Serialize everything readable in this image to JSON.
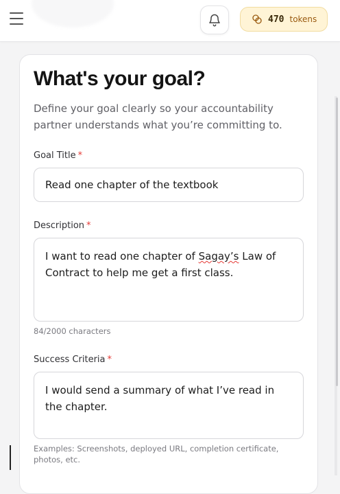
{
  "header": {
    "tokens_count": "470",
    "tokens_label": "tokens"
  },
  "form": {
    "title": "What's your goal?",
    "subtitle": "Define your goal clearly so your accountability partner understands what you’re committing to.",
    "required_marker": "*",
    "goal_title": {
      "label": "Goal Title",
      "value": "Read one chapter of the textbook"
    },
    "description": {
      "label": "Description",
      "value_before": "I want to read one chapter of ",
      "value_misspelled": "Sagay’s",
      "value_after": " Law of Contract to help me get a first class.",
      "char_count": "84/2000 characters"
    },
    "success_criteria": {
      "label": "Success Criteria",
      "value": "I would send a summary of what I’ve read in the chapter.",
      "helper": "Examples: Screenshots, deployed URL, completion certificate, photos, etc."
    }
  },
  "colors": {
    "required": "#e53935",
    "token_pill_bg": "#fff4d6",
    "token_text": "#9a5a10"
  },
  "icons": [
    "menu-icon",
    "bell-icon",
    "coins-icon"
  ]
}
